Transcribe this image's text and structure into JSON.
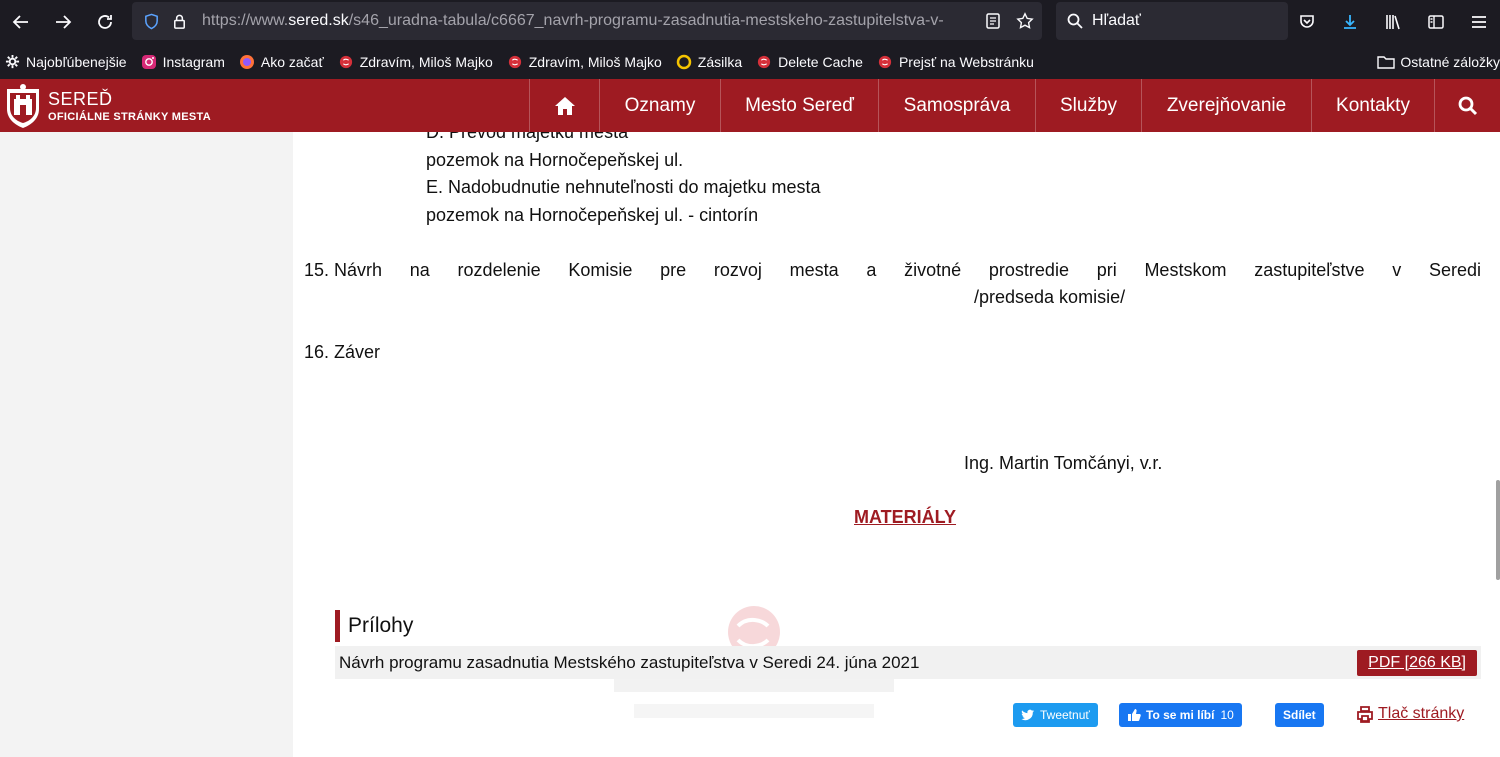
{
  "browser": {
    "url_prefix": "https://www.",
    "url_domain": "sered.sk",
    "url_path": "/s46_uradna-tabula/c6667_navrh-programu-zasadnutia-mestskeho-zastupitelstva-v-",
    "search_placeholder": "Hľadať"
  },
  "bookmarks": [
    {
      "label": "Najobľúbenejšie",
      "icon": "gear-icon"
    },
    {
      "label": "Instagram",
      "icon": "instagram-icon"
    },
    {
      "label": "Ako začať",
      "icon": "firefox-icon"
    },
    {
      "label": "Zdravím, Miloš Majko",
      "icon": "sered-icon"
    },
    {
      "label": "Zdravím, Miloš Majko",
      "icon": "sered-icon"
    },
    {
      "label": "Zásilka",
      "icon": "zasilka-icon"
    },
    {
      "label": "Delete Cache",
      "icon": "sered-icon"
    },
    {
      "label": "Prejsť na Webstránku",
      "icon": "sered-icon"
    }
  ],
  "bookmarks_other": "Ostatné záložky",
  "site": {
    "name": "SEREĎ",
    "subtitle": "OFICIÁLNE STRÁNKY MESTA",
    "brand_color": "#9e1b22",
    "menu": [
      "Oznamy",
      "Mesto Sereď",
      "Samospráva",
      "Služby",
      "Zverejňovanie",
      "Kontakty"
    ]
  },
  "content": {
    "line_d": "D.      Prevod majetku mesta",
    "line_d2": "pozemok na Hornočepeňskej ul.",
    "line_e": "E.      Nadobudnutie nehnuteľnosti do majetku mesta",
    "line_e2": "pozemok na Hornočepeňskej ul. - cintorín",
    "item15_words": [
      "15. Návrh",
      "na",
      "rozdelenie",
      "Komisie",
      "pre",
      "rozvoj",
      "mesta",
      "a",
      "životné",
      "prostredie",
      "pri",
      "Mestskom",
      "zastupiteľstve",
      "v",
      "Seredi"
    ],
    "item15_sub": "/predseda komisie/",
    "item16": "16. Záver",
    "signature": "Ing. Martin Tomčányi, v.r.",
    "materials_heading": "MATERIÁLY"
  },
  "attachments": {
    "title": "Prílohy",
    "file_name": "Návrh programu zasadnutia Mestského zastupiteľstva v Seredi 24. júna 2021",
    "file_button": "PDF [266 KB]"
  },
  "share": {
    "tweet": "Tweetnuť",
    "like": "To se mi líbí",
    "like_count": "10",
    "share": "Sdílet",
    "print": "Tlač stránky"
  }
}
